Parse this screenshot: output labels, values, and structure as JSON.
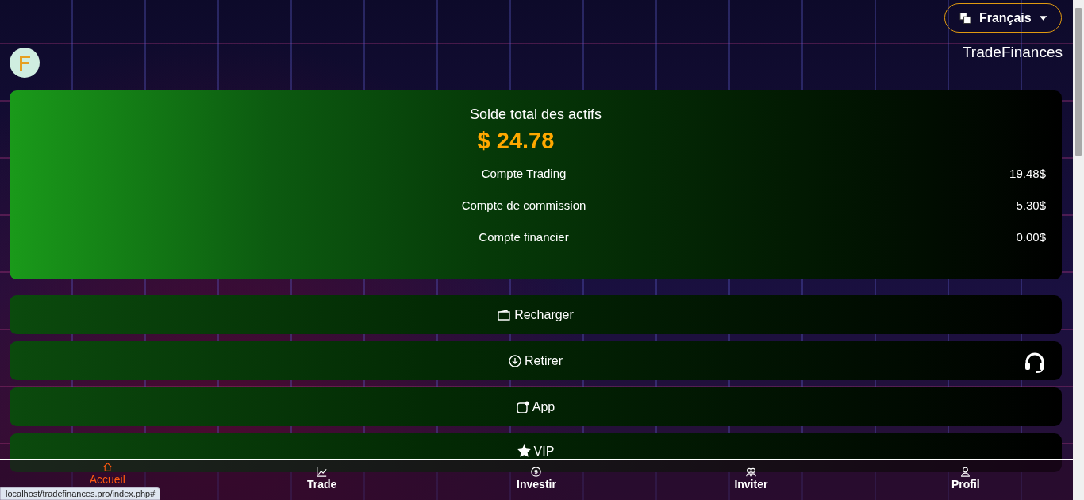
{
  "header": {
    "language": "Français",
    "brand": "TradeFinances"
  },
  "balance": {
    "title": "Solde total des actifs",
    "amount": "$ 24.78",
    "accounts": [
      {
        "label": "Compte Trading",
        "value": "19.48$"
      },
      {
        "label": "Compte de commission",
        "value": "5.30$"
      },
      {
        "label": "Compte financier",
        "value": "0.00$"
      }
    ]
  },
  "actions": [
    {
      "kind": "wallet",
      "label": "Recharger"
    },
    {
      "kind": "download",
      "label": "Retirer"
    },
    {
      "kind": "app",
      "label": "App"
    },
    {
      "kind": "star",
      "label": "VIP"
    }
  ],
  "nav": [
    {
      "kind": "home",
      "label": "Accueil",
      "selected": true
    },
    {
      "kind": "chart",
      "label": "Trade",
      "selected": false
    },
    {
      "kind": "coin",
      "label": "Investir",
      "selected": false
    },
    {
      "kind": "people",
      "label": "Inviter",
      "selected": false
    },
    {
      "kind": "person",
      "label": "Profil",
      "selected": false
    }
  ],
  "status_url": "localhost/tradefinances.pro/index.php#"
}
